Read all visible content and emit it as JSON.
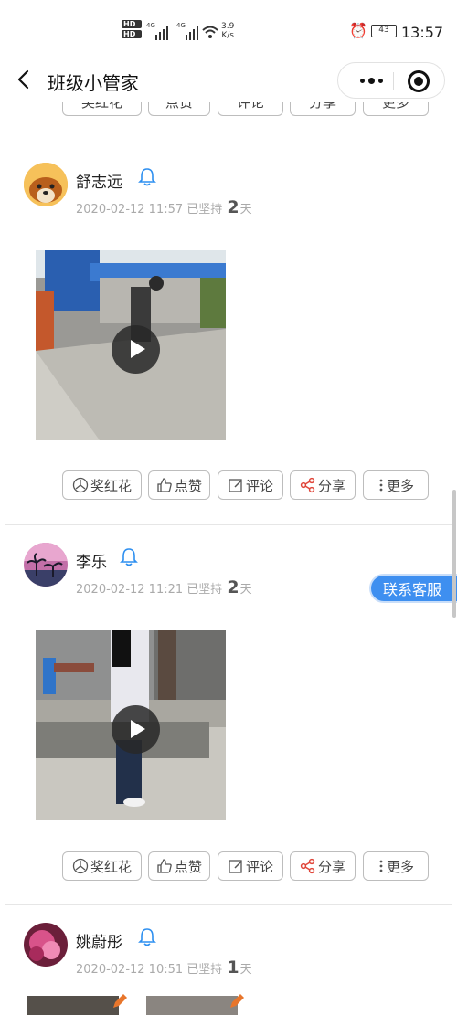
{
  "status_bar": {
    "hd1": "HD",
    "hd2": "HD",
    "net1": "4G",
    "net2": "4G",
    "speed_value": "3.9",
    "speed_unit": "K/s",
    "battery": "43",
    "time": "13:57"
  },
  "nav": {
    "title": "班级小管家"
  },
  "actions": {
    "flower": "奖红花",
    "like": "点赞",
    "comment": "评论",
    "share": "分享",
    "more": "更多"
  },
  "posts": [
    {
      "name": "舒志远",
      "date": "2020-02-12 11:57 已坚持",
      "days": "2",
      "unit": "天"
    },
    {
      "name": "李乐",
      "date": "2020-02-12 11:21 已坚持",
      "days": "2",
      "unit": "天"
    },
    {
      "name": "姚蔚彤",
      "date": "2020-02-12 10:51 已坚持",
      "days": "1",
      "unit": "天"
    }
  ],
  "customer_service": "联系客服",
  "colors": {
    "accent_blue": "#3e8ff0",
    "share_red": "#e0463a",
    "bell_blue": "#2d8ff0"
  }
}
